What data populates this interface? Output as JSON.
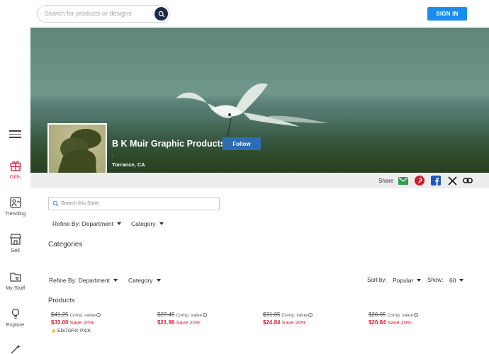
{
  "header": {
    "search_placeholder": "Search for products or designs",
    "signin_label": "SIGN IN"
  },
  "rail": {
    "items": [
      {
        "label": "Gifts",
        "icon": "gift-icon"
      },
      {
        "label": "Trending",
        "icon": "trending-icon"
      },
      {
        "label": "Sell",
        "icon": "store-icon"
      },
      {
        "label": "My Stuff",
        "icon": "folder-heart-icon"
      },
      {
        "label": "Explore",
        "icon": "lightbulb-icon"
      }
    ]
  },
  "shop": {
    "name": "B K Muir Graphic Products",
    "follow_label": "Follow",
    "separator": ".",
    "location": "Torrance, CA"
  },
  "share": {
    "label": "Share",
    "icons": [
      "email-icon",
      "pinterest-icon",
      "facebook-icon",
      "x-icon",
      "link-icon"
    ]
  },
  "store": {
    "search_placeholder": "Search this Store",
    "refine_label": "Refine By: Department",
    "category_label": "Category",
    "categories_title": "Categories",
    "refine_label_2": "Refine By: Department",
    "category_label_2": "Category",
    "sort_by_label": "Sort by:",
    "sort_value": "Popular",
    "show_label": "Show:",
    "show_value": "60",
    "products_title": "Products"
  },
  "products": [
    {
      "orig": "$41.25",
      "comp": "Comp. value",
      "sale": "$33.00",
      "save": "Save 20%",
      "badge": "EDITORS' PICK"
    },
    {
      "orig": "$27.45",
      "comp": "Comp. value",
      "sale": "$21.96",
      "save": "Save 20%",
      "badge": ""
    },
    {
      "orig": "$31.05",
      "comp": "Comp. value",
      "sale": "$24.84",
      "save": "Save 20%",
      "badge": ""
    },
    {
      "orig": "$26.05",
      "comp": "Comp. value",
      "sale": "$20.84",
      "save": "Save 20%",
      "badge": ""
    }
  ],
  "colors": {
    "accent_blue": "#1a8cf0",
    "follow_blue": "#2d6db5",
    "sale_red": "#d8203a",
    "nav_navy": "#1c2a4a"
  }
}
